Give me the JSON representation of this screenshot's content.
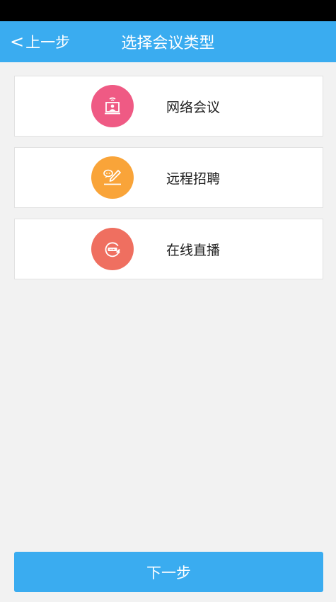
{
  "header": {
    "back_chevron": "<",
    "back_label": "上一步",
    "title": "选择会议类型"
  },
  "options": [
    {
      "label": "网络会议",
      "icon": "video-conference-icon",
      "color": "#ef5a84"
    },
    {
      "label": "远程招聘",
      "icon": "chat-write-icon",
      "color": "#f9a439"
    },
    {
      "label": "在线直播",
      "icon": "live-stream-icon",
      "color": "#ef6f60"
    }
  ],
  "footer": {
    "next_label": "下一步"
  },
  "colors": {
    "accent": "#3aacf0",
    "background": "#f2f2f2"
  }
}
